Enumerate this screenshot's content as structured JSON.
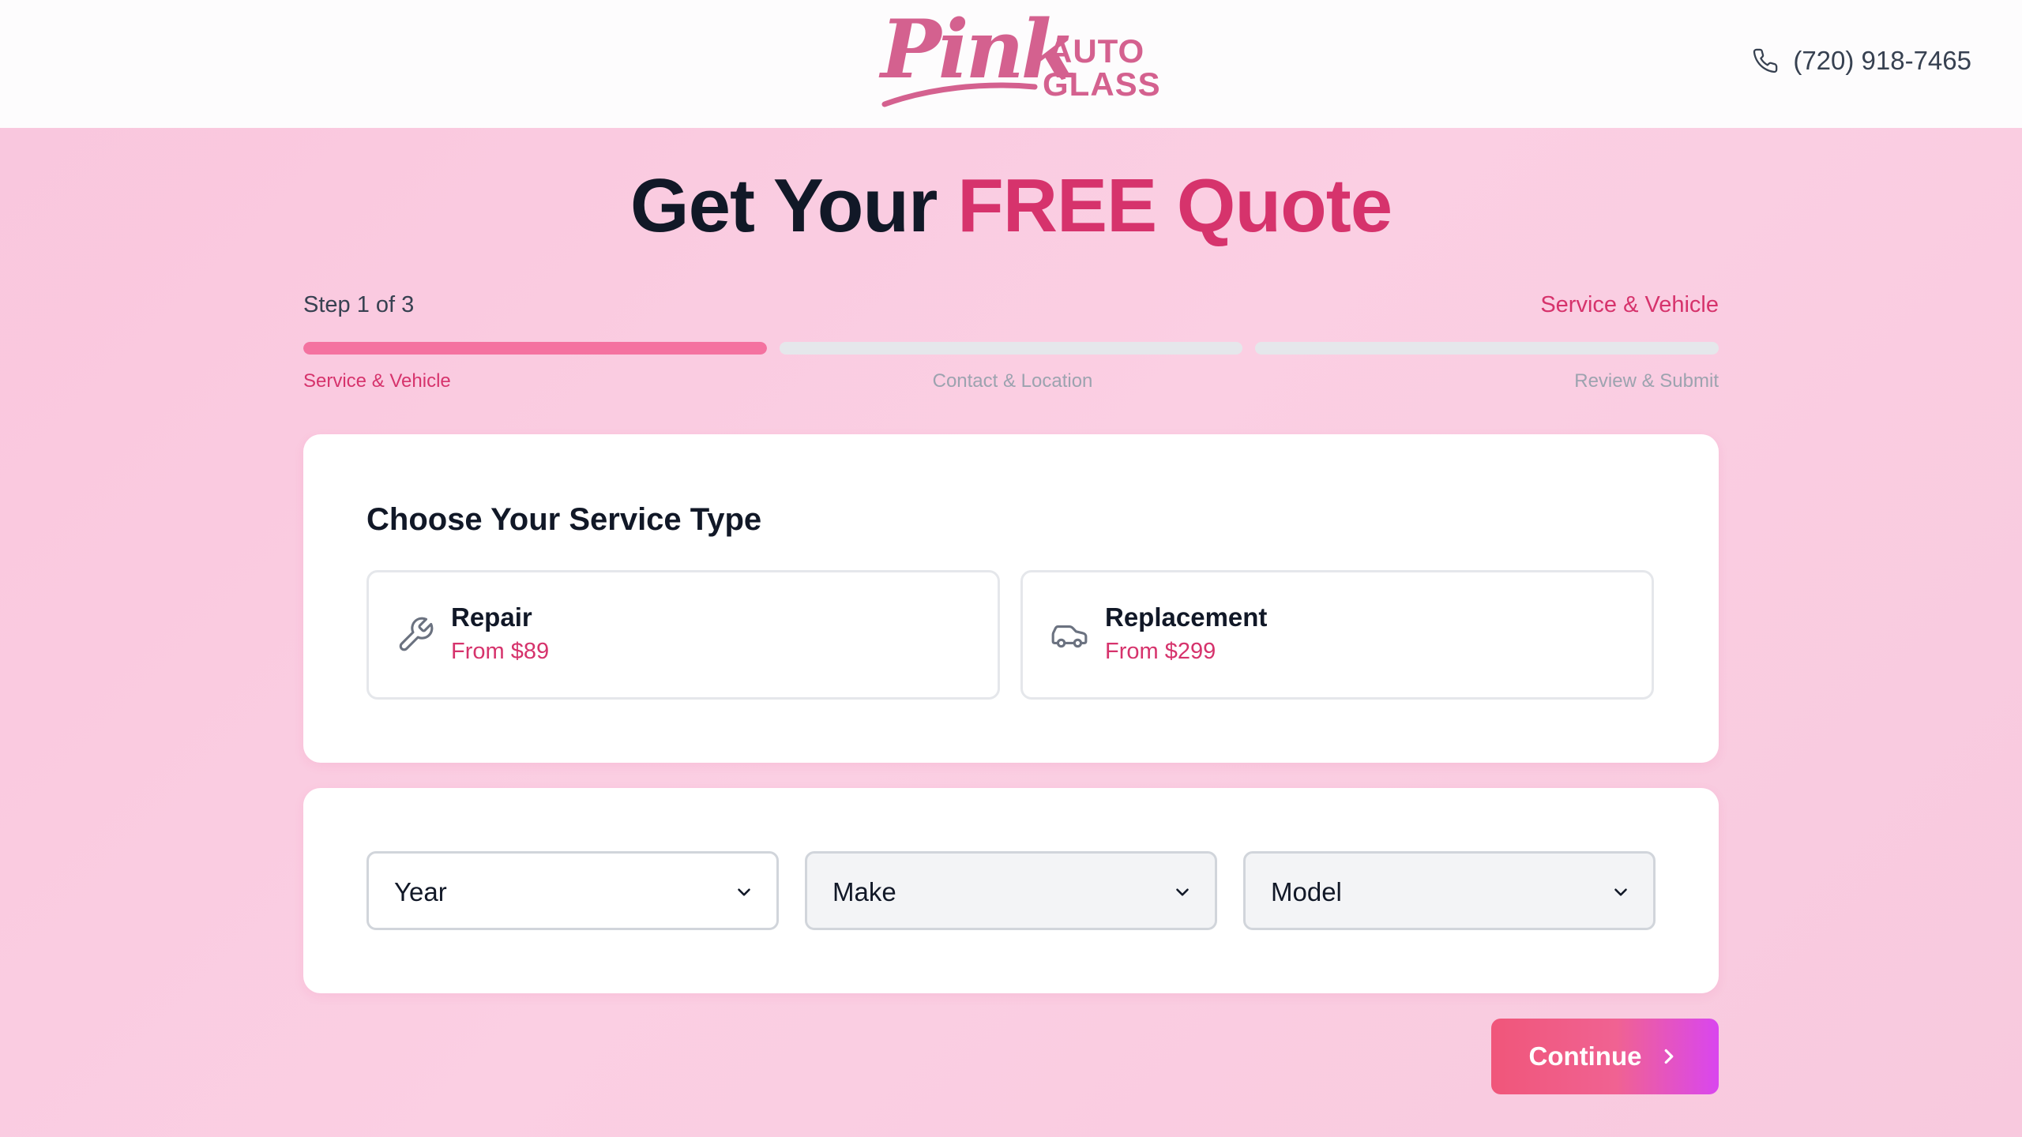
{
  "brand": {
    "script": "Pink",
    "line1": "AUTO",
    "line2": "GLASS",
    "color": "#d4618f"
  },
  "header": {
    "phone": "(720) 918-7465",
    "phone_icon": "phone-icon"
  },
  "title": {
    "prefix": "Get Your",
    "accent": "FREE Quote",
    "accent_color": "#d6336c"
  },
  "progress": {
    "step_text": "Step 1 of 3",
    "current_label": "Service & Vehicle",
    "current_step": 1,
    "total_steps": 3,
    "steps": [
      "Service & Vehicle",
      "Contact & Location",
      "Review & Submit"
    ]
  },
  "service": {
    "heading": "Choose Your Service Type",
    "options": [
      {
        "name": "Repair",
        "price": "From $89",
        "icon": "wrench-icon"
      },
      {
        "name": "Replacement",
        "price": "From $299",
        "icon": "car-icon"
      }
    ]
  },
  "vehicle": {
    "year": "Year",
    "make": "Make",
    "model": "Model"
  },
  "actions": {
    "continue": "Continue"
  }
}
